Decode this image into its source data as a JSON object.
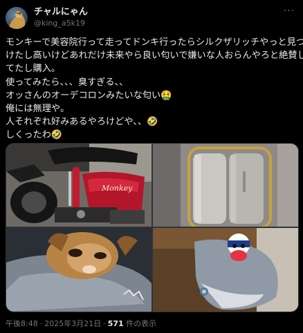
{
  "author": {
    "display_name": "チャルにゃん",
    "handle": "@king_a5k19"
  },
  "header": {
    "more_label": "···"
  },
  "tweet": {
    "lines": [
      "モンキーで美容院行って走ってドンキ行ったらシルクザリッチやっと見つ",
      "けたし高いけどあれだけ未来やら良い匂いで嫌いな人おらんやろと絶賛し",
      "てたし購入。",
      "使ってみたら、、、臭すぎる、、",
      "オッさんのオーデコロンみたいな匂い🤮",
      "俺には無理や。",
      "人それぞれ好みあるやろけどや、、🤣",
      "しくったわ🤣"
    ]
  },
  "media": [
    {
      "icon": "motorcycle-photo",
      "brand_text": "Monkey"
    },
    {
      "icon": "bottle-photo"
    },
    {
      "icon": "dog-photo"
    },
    {
      "icon": "shark-plush-photo"
    }
  ],
  "meta": {
    "time": "午後8:48",
    "date": "2025年3月21日",
    "views_count": "571",
    "views_label": "件の表示"
  },
  "colors": {
    "background": "#000000",
    "text": "#e7e9ea",
    "secondary": "#71767b",
    "border": "#2f3336"
  }
}
